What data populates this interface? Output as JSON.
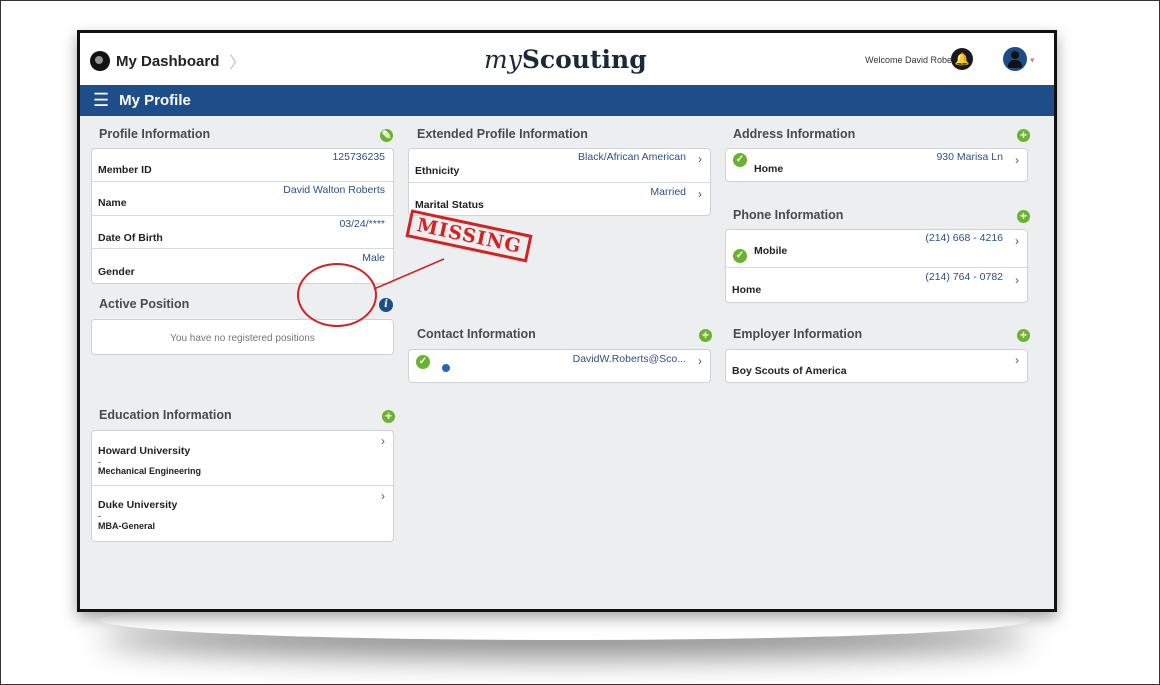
{
  "header": {
    "dashboard_label": "My Dashboard",
    "brand_my": "my",
    "brand_name": "Scouting",
    "welcome": "Welcome David Roberts"
  },
  "nav": {
    "title": "My Profile"
  },
  "profile": {
    "title": "Profile Information",
    "rows": [
      {
        "label": "Member ID",
        "value": "125736235"
      },
      {
        "label": "Name",
        "value": "David Walton Roberts"
      },
      {
        "label": "Date Of Birth",
        "value": "03/24/****"
      },
      {
        "label": "Gender",
        "value": "Male"
      }
    ]
  },
  "active_position": {
    "title": "Active Position",
    "empty": "You have no registered positions"
  },
  "education": {
    "title": "Education Information",
    "items": [
      {
        "school": "Howard University",
        "sep": "-",
        "program": "Mechanical Engineering"
      },
      {
        "school": "Duke University",
        "sep": "-",
        "program": "MBA-General"
      }
    ]
  },
  "extended": {
    "title": "Extended Profile Information",
    "rows": [
      {
        "label": "Ethnicity",
        "value": "Black/African American"
      },
      {
        "label": "Marital Status",
        "value": "Married"
      }
    ]
  },
  "annotation": {
    "stamp": "MISSING"
  },
  "contact": {
    "title": "Contact Information",
    "email": "DavidW.Roberts@Sco..."
  },
  "address": {
    "title": "Address Information",
    "rows": [
      {
        "label": "Home",
        "value": "930 Marisa Ln"
      }
    ]
  },
  "phone": {
    "title": "Phone Information",
    "rows": [
      {
        "label": "Mobile",
        "value": "(214) 668 - 4216"
      },
      {
        "label": "Home",
        "value": "(214) 764 - 0782"
      }
    ]
  },
  "employer": {
    "title": "Employer Information",
    "name": "Boy Scouts of America"
  },
  "colors": {
    "nav": "#1d4e8a",
    "accent_green": "#6ab32e",
    "value_blue": "#2d4f85",
    "annotation_red": "#d32222"
  }
}
